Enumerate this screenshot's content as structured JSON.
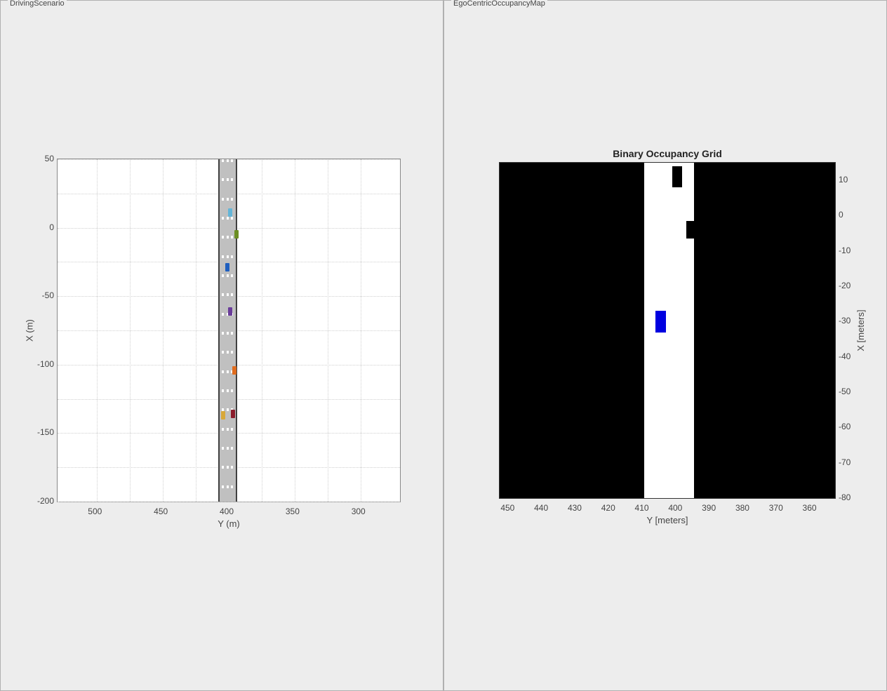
{
  "left_panel": {
    "title": "DrivingScenario"
  },
  "right_panel": {
    "title": "EgoCentricOccupancyMap"
  },
  "chart_data": [
    {
      "type": "scatter",
      "name": "DrivingScenario",
      "xlabel": "Y (m)",
      "ylabel": "X (m)",
      "x_ticks": [
        500,
        450,
        400,
        350,
        300
      ],
      "y_ticks": [
        50,
        0,
        -50,
        -100,
        -150,
        -200
      ],
      "x_range_reversed": true,
      "x_range": [
        270,
        530
      ],
      "y_range": [
        -200,
        50
      ],
      "road": {
        "y_center": 402,
        "width_m": 12
      },
      "vehicles": [
        {
          "id": "veh-cyan",
          "color": "#64b5d8",
          "y": 399,
          "x": 11
        },
        {
          "id": "veh-green",
          "color": "#6b8e23",
          "y": 394,
          "x": -5
        },
        {
          "id": "veh-blue",
          "color": "#1f5fbf",
          "y": 401,
          "x": -29
        },
        {
          "id": "veh-purple",
          "color": "#6a3d9a",
          "y": 399,
          "x": -61
        },
        {
          "id": "veh-orange",
          "color": "#e06c1e",
          "y": 396,
          "x": -104
        },
        {
          "id": "veh-yellow",
          "color": "#d8a83a",
          "y": 404,
          "x": -137
        },
        {
          "id": "veh-maroon",
          "color": "#8b1c2b",
          "y": 397,
          "x": -136
        }
      ]
    },
    {
      "type": "heatmap",
      "name": "EgoCentricOccupancyMap",
      "title": "Binary Occupancy Grid",
      "xlabel": "Y [meters]",
      "ylabel": "X [meters]",
      "x_ticks": [
        450,
        440,
        430,
        420,
        410,
        400,
        390,
        380,
        370,
        360
      ],
      "y_ticks": [
        10,
        0,
        -10,
        -20,
        -30,
        -40,
        -50,
        -60,
        -70,
        -80
      ],
      "x_range_reversed": true,
      "x_range": [
        353,
        453
      ],
      "y_range": [
        -80,
        15
      ],
      "free_corridor": {
        "y_min": 395,
        "y_max": 410
      },
      "ego_vehicle": {
        "y_center": 405,
        "x_center": -30,
        "color": "#0000e0"
      },
      "obstacles": [
        {
          "y_center": 400,
          "x_center": 11,
          "w": 3,
          "h": 6
        },
        {
          "y_center": 396,
          "x_center": -4,
          "w": 2.5,
          "h": 5
        }
      ]
    }
  ]
}
